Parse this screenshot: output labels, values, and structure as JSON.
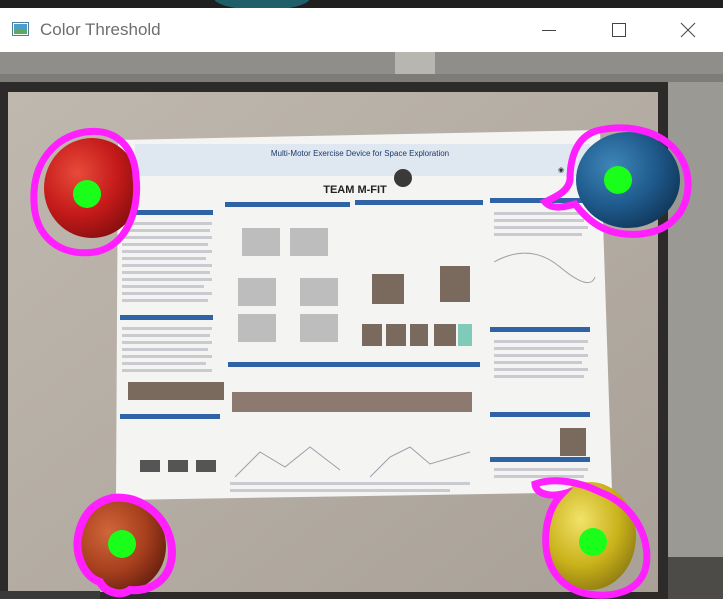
{
  "window": {
    "title": "Color Threshold",
    "controls": [
      "minimize",
      "maximize",
      "close"
    ],
    "icons": {
      "app": "image-window-icon",
      "minimize": "minimize-icon",
      "maximize": "maximize-icon",
      "close": "close-icon"
    }
  },
  "poster": {
    "title": "Multi-Motor Exercise Device for Space Exploration",
    "team": "TEAM M-FIT"
  },
  "balloons": [
    {
      "name": "red-balloon",
      "color": "#c41a1a",
      "outline": "#ff1fff",
      "marker": "#1aff1a"
    },
    {
      "name": "blue-balloon",
      "color": "#1f5a8c",
      "outline": "#ff1fff",
      "marker": "#1aff1a"
    },
    {
      "name": "orange-balloon",
      "color": "#a8401e",
      "outline": "#ff1fff",
      "marker": "#1aff1a"
    },
    {
      "name": "yellow-balloon",
      "color": "#c9b21a",
      "outline": "#ff1fff",
      "marker": "#1aff1a"
    }
  ]
}
